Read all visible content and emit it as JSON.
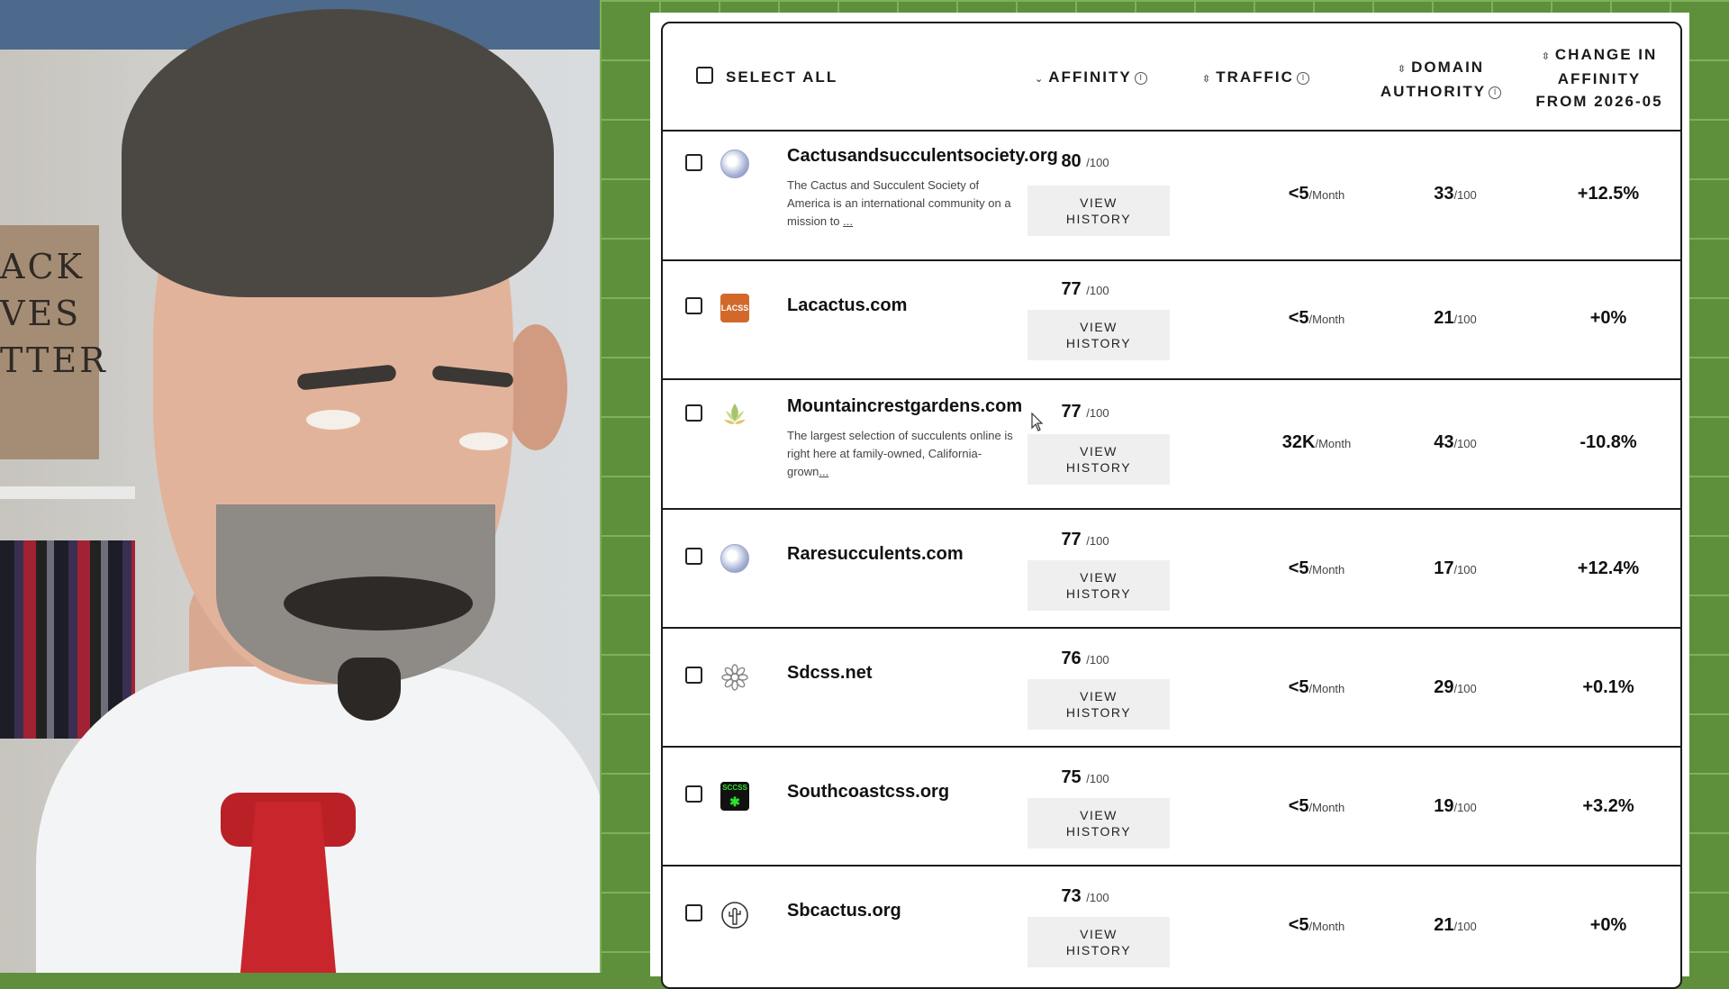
{
  "presenter": {
    "poster_lines": [
      "ACK",
      "VES",
      "TTER"
    ]
  },
  "table": {
    "select_all_label": "SELECT ALL",
    "columns": {
      "affinity": "AFFINITY",
      "traffic": "TRAFFIC",
      "domain_authority_line1": "DOMAIN",
      "domain_authority_line2": "AUTHORITY",
      "change_line1": "CHANGE IN",
      "change_line2": "AFFINITY",
      "change_line3": "FROM 2026-05"
    },
    "score_suffix": "/100",
    "traffic_suffix": "/Month",
    "view_history_line1": "VIEW",
    "view_history_line2": "HISTORY",
    "rows": [
      {
        "domain": "Cactusandsucculentsociety.org",
        "description": "The Cactus and Succulent Society of America is an international community on a mission to",
        "more": "...",
        "affinity": "80",
        "traffic": "<5",
        "da": "33",
        "change": "+12.5%",
        "logo": "globe-icon"
      },
      {
        "domain": "Lacactus.com",
        "description": "",
        "more": "",
        "affinity": "77",
        "traffic": "<5",
        "da": "21",
        "change": "+0%",
        "logo": "lacss-logo",
        "logo_text": "LACSS"
      },
      {
        "domain": "Mountaincrestgardens.com",
        "description": "The largest selection of succulents online is right here at family-owned, California-grown",
        "more": "...",
        "affinity": "77",
        "traffic": "32K",
        "da": "43",
        "change": "-10.8%",
        "logo": "succulent-logo"
      },
      {
        "domain": "Raresucculents.com",
        "description": "",
        "more": "",
        "affinity": "77",
        "traffic": "<5",
        "da": "17",
        "change": "+12.4%",
        "logo": "globe-icon"
      },
      {
        "domain": "Sdcss.net",
        "description": "",
        "more": "",
        "affinity": "76",
        "traffic": "<5",
        "da": "29",
        "change": "+0.1%",
        "logo": "flower-logo"
      },
      {
        "domain": "Southcoastcss.org",
        "description": "",
        "more": "",
        "affinity": "75",
        "traffic": "<5",
        "da": "19",
        "change": "+3.2%",
        "logo": "sccss-logo",
        "logo_text": "SCCSS"
      },
      {
        "domain": "Sbcactus.org",
        "description": "",
        "more": "",
        "affinity": "73",
        "traffic": "<5",
        "da": "21",
        "change": "+0%",
        "logo": "cactus-circle-logo"
      }
    ]
  },
  "colors": {
    "background_green": "#5e8f3a",
    "grid_green": "#7fb05a",
    "lacss_orange": "#d2692a",
    "sccss_green": "#18a21a"
  }
}
